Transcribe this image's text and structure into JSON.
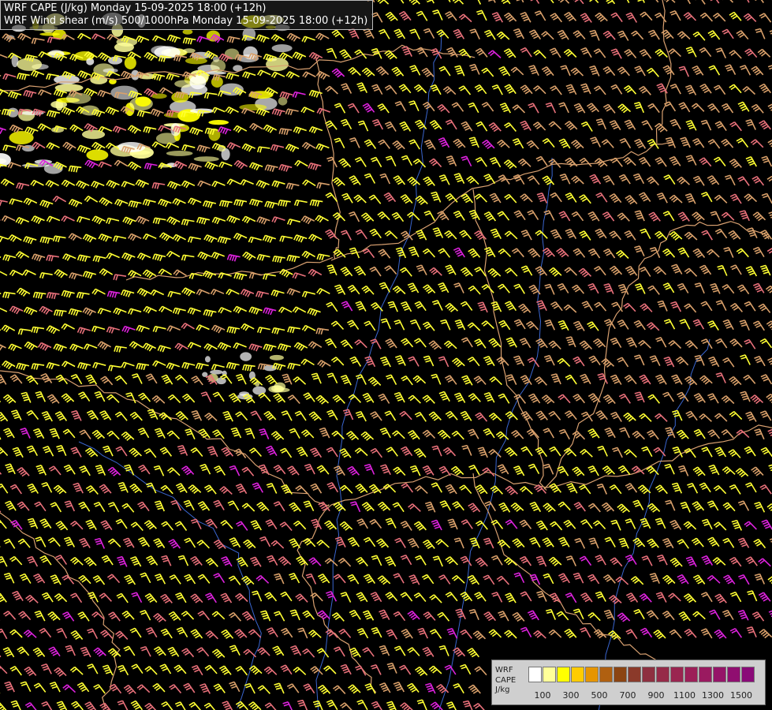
{
  "titles": {
    "line1": "WRF CAPE (J/kg) Monday 15-09-2025 18:00 (+12h)",
    "line2": "WRF Wind shear (m/s) 500/1000hPa Monday 15-09-2025 18:00 (+12h)"
  },
  "legend": {
    "model": "WRF",
    "field": "CAPE",
    "unit": "J/kg",
    "colors": [
      "#ffffff",
      "#ffff99",
      "#ffff00",
      "#ffcc00",
      "#e69500",
      "#b06010",
      "#8b4513",
      "#8b3a2a",
      "#8e3040",
      "#962a48",
      "#9a2550",
      "#9c1f58",
      "#9a1a60",
      "#951468",
      "#900e70",
      "#8a0a78"
    ],
    "tick_labels": [
      "100",
      "300",
      "500",
      "700",
      "900",
      "1100",
      "1300",
      "1500"
    ]
  },
  "map": {
    "background": "#000000",
    "barb_colors": {
      "low": "#ffff33",
      "mid": "#d9a06a",
      "high": "#e8707a",
      "extreme": "#dd22dd"
    },
    "border_color": "#d8a070",
    "river_color": "#3a66d0",
    "cape_cloud_colors": [
      "#ffffff",
      "#ffff99",
      "#ffff00"
    ]
  }
}
